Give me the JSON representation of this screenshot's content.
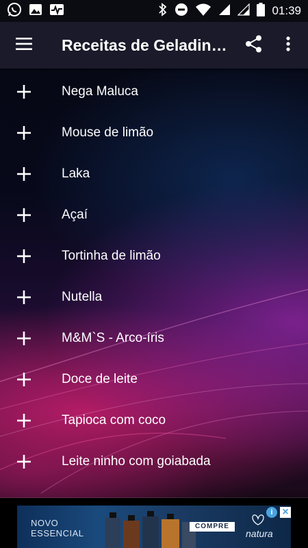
{
  "status_bar": {
    "time": "01:39",
    "left_icons": [
      "whatsapp-icon",
      "image-icon",
      "pulse-icon"
    ],
    "right_icons": [
      "bluetooth-icon",
      "do-not-disturb-icon",
      "wifi-icon",
      "signal-icon",
      "signal-icon",
      "battery-icon"
    ]
  },
  "app_bar": {
    "title": "Receitas de Geladin…",
    "icons": {
      "menu": "menu-icon",
      "share": "share-icon",
      "more": "more-vert-icon"
    }
  },
  "list": {
    "items": [
      {
        "label": "Nega Maluca"
      },
      {
        "label": "Mouse de limão"
      },
      {
        "label": "Laka"
      },
      {
        "label": "Açaí"
      },
      {
        "label": "Tortinha de limão"
      },
      {
        "label": "Nutella"
      },
      {
        "label": "M&M`S - Arco-íris"
      },
      {
        "label": "Doce de leite"
      },
      {
        "label": "Tapioca com coco"
      },
      {
        "label": "Leite ninho com goiabada"
      }
    ]
  },
  "ad": {
    "brand_line1": "NOVO",
    "brand_line2": "ESSENCIAL",
    "cta": "COMPRE",
    "logo": "natura",
    "info_icon": "i",
    "close_icon": "×"
  },
  "colors": {
    "app_bar": "#1b1a2a",
    "status_bar": "#0b0b12",
    "accent_magenta": "#c81e6e",
    "text": "#ffffff"
  }
}
